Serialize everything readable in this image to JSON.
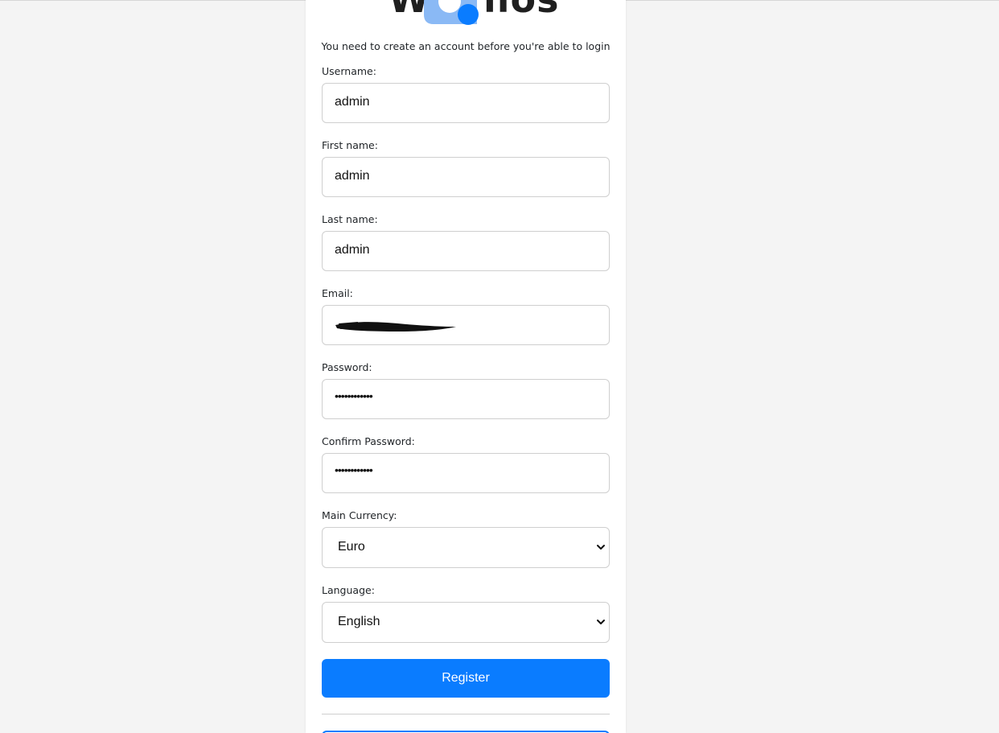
{
  "logo": {
    "left_text": "W",
    "right_text": "llos",
    "colors": {
      "light": "#8ab9f5",
      "dark": "#0a7cff",
      "text": "#1f1f1f"
    }
  },
  "intro_text": "You need to create an account before you're able to login",
  "form": {
    "username": {
      "label": "Username:",
      "value": "admin"
    },
    "first_name": {
      "label": "First name:",
      "value": "admin"
    },
    "last_name": {
      "label": "Last name:",
      "value": "admin"
    },
    "email": {
      "label": "Email:",
      "value": ""
    },
    "password": {
      "label": "Password:",
      "value": "••••••••••••"
    },
    "confirm_password": {
      "label": "Confirm Password:",
      "value": "••••••••••••"
    },
    "main_currency": {
      "label": "Main Currency:",
      "selected": "Euro"
    },
    "language": {
      "label": "Language:",
      "selected": "English"
    }
  },
  "register_button": {
    "label": "Register",
    "color": "#0a7cff"
  },
  "icons": {
    "select_chevron": "chevron-down-icon",
    "redaction": "redaction-mark"
  }
}
